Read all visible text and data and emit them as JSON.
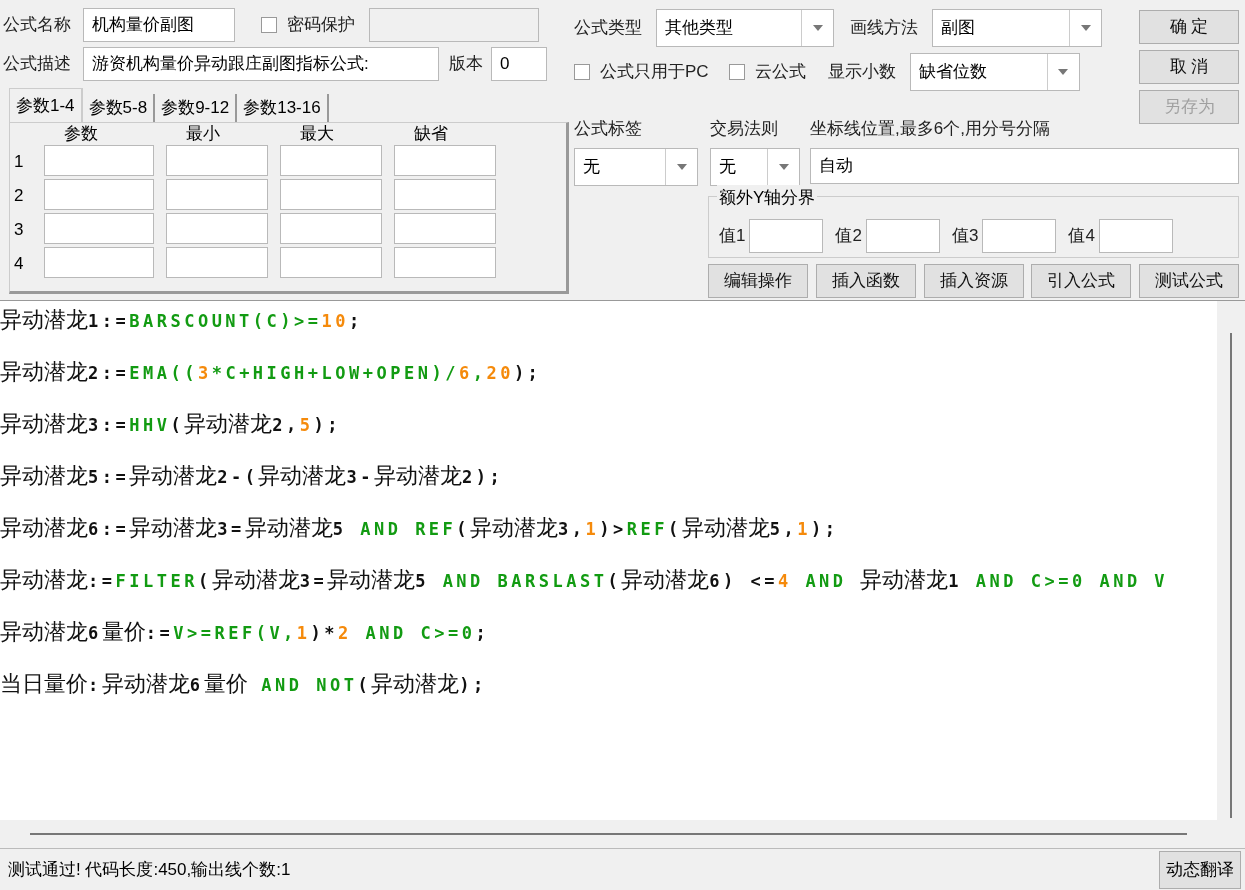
{
  "formula_name": {
    "label": "公式名称",
    "value": "机构量价副图"
  },
  "password": {
    "label": "密码保护",
    "checked": false
  },
  "description": {
    "label": "公式描述",
    "value": "游资机构量价异动跟庄副图指标公式:"
  },
  "version": {
    "label": "版本",
    "value": "0"
  },
  "param_tabs": [
    {
      "label": "参数1-4",
      "selected": true
    },
    {
      "label": "参数5-8",
      "selected": false
    },
    {
      "label": "参数9-12",
      "selected": false
    },
    {
      "label": "参数13-16",
      "selected": false
    }
  ],
  "param_table": {
    "columns": [
      "参数",
      "最小",
      "最大",
      "缺省"
    ],
    "rows": [
      "1",
      "2",
      "3",
      "4"
    ]
  },
  "formula_type": {
    "label": "公式类型",
    "value": "其他类型"
  },
  "draw_method": {
    "label": "画线方法",
    "value": "副图"
  },
  "pc_only": {
    "label": "公式只用于PC",
    "checked": false
  },
  "cloud": {
    "label": "云公式",
    "checked": false
  },
  "decimals": {
    "label": "显示小数",
    "value": "缺省位数"
  },
  "dialog_buttons": [
    {
      "label": "确 定",
      "disabled": false
    },
    {
      "label": "取 消",
      "disabled": false
    },
    {
      "label": "另存为",
      "disabled": true
    }
  ],
  "tag": {
    "label": "公式标签",
    "value": "无"
  },
  "trade_rule": {
    "label": "交易法则",
    "value": "无"
  },
  "axis_lines": {
    "label": "坐标线位置,最多6个,用分号分隔",
    "value": "自动"
  },
  "y_bounds": {
    "title": "额外Y轴分界",
    "fields": [
      "值1",
      "值2",
      "值3",
      "值4"
    ]
  },
  "tool_buttons": [
    "编辑操作",
    "插入函数",
    "插入资源",
    "引入公式",
    "测试公式"
  ],
  "code_lines": [
    [
      {
        "kind": "t",
        "text": "异动潜龙1:="
      },
      {
        "kind": "f",
        "text": "BARSCOUNT(C)>="
      },
      {
        "kind": "n",
        "text": "10"
      },
      {
        "kind": "t",
        "text": ";"
      }
    ],
    [
      {
        "kind": "t",
        "text": "异动潜龙2:="
      },
      {
        "kind": "f",
        "text": "EMA(("
      },
      {
        "kind": "n",
        "text": "3"
      },
      {
        "kind": "f",
        "text": "*C+HIGH+LOW+OPEN)/"
      },
      {
        "kind": "n",
        "text": "6"
      },
      {
        "kind": "f",
        "text": ","
      },
      {
        "kind": "n",
        "text": "20"
      },
      {
        "kind": "t",
        "text": ");"
      }
    ],
    [
      {
        "kind": "t",
        "text": "异动潜龙3:="
      },
      {
        "kind": "f",
        "text": "HHV"
      },
      {
        "kind": "t",
        "text": "(异动潜龙2,"
      },
      {
        "kind": "n",
        "text": "5"
      },
      {
        "kind": "t",
        "text": ");"
      }
    ],
    [
      {
        "kind": "t",
        "text": "异动潜龙5:=异动潜龙2-(异动潜龙3-异动潜龙2);"
      }
    ],
    [
      {
        "kind": "t",
        "text": "异动潜龙6:=异动潜龙3=异动潜龙5 "
      },
      {
        "kind": "f",
        "text": "AND REF"
      },
      {
        "kind": "t",
        "text": "(异动潜龙3,"
      },
      {
        "kind": "n",
        "text": "1"
      },
      {
        "kind": "t",
        "text": ")>"
      },
      {
        "kind": "f",
        "text": "REF"
      },
      {
        "kind": "t",
        "text": "(异动潜龙5,"
      },
      {
        "kind": "n",
        "text": "1"
      },
      {
        "kind": "t",
        "text": ");"
      }
    ],
    [
      {
        "kind": "t",
        "text": "异动潜龙:="
      },
      {
        "kind": "f",
        "text": "FILTER"
      },
      {
        "kind": "t",
        "text": "(异动潜龙3=异动潜龙5 "
      },
      {
        "kind": "f",
        "text": "AND BARSLAST"
      },
      {
        "kind": "t",
        "text": "(异动潜龙6) <="
      },
      {
        "kind": "n",
        "text": "4"
      },
      {
        "kind": "f",
        "text": " AND "
      },
      {
        "kind": "t",
        "text": "异动潜龙1 "
      },
      {
        "kind": "f",
        "text": "AND C>=0 AND V"
      }
    ],
    [
      {
        "kind": "t",
        "text": "异动潜龙6量价:="
      },
      {
        "kind": "f",
        "text": "V>=REF(V,"
      },
      {
        "kind": "n",
        "text": "1"
      },
      {
        "kind": "t",
        "text": ")*"
      },
      {
        "kind": "n",
        "text": "2"
      },
      {
        "kind": "f",
        "text": " AND C>=0"
      },
      {
        "kind": "t",
        "text": ";"
      }
    ],
    [
      {
        "kind": "t",
        "text": "当日量价:异动潜龙6量价 "
      },
      {
        "kind": "f",
        "text": "AND NOT"
      },
      {
        "kind": "t",
        "text": "(异动潜龙);"
      }
    ]
  ],
  "status": "测试通过! 代码长度:450,输出线个数:1",
  "translate_button": "动态翻译"
}
